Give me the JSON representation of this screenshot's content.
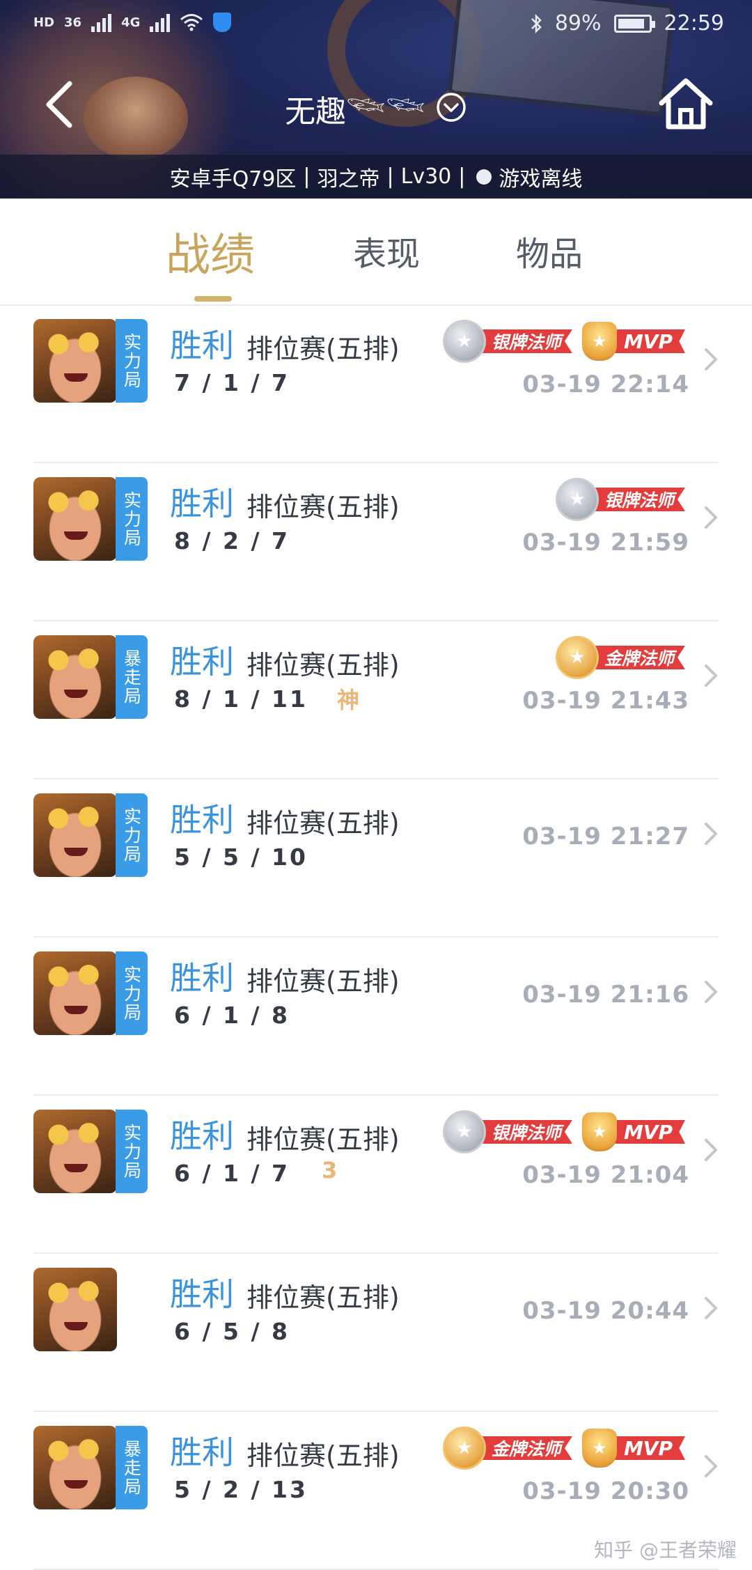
{
  "status_bar": {
    "network": "36",
    "network2": "4G",
    "carrier_label": "HD",
    "battery_percent": "89%",
    "battery_level": 0.89,
    "time": "22:59"
  },
  "header": {
    "title": "无趣𓆝𓆝",
    "info": {
      "server": "安卓手Q79区",
      "rank": "羽之帝",
      "level": "Lv30",
      "status": "游戏离线"
    }
  },
  "tabs": [
    {
      "label": "战绩",
      "active": true
    },
    {
      "label": "表现",
      "active": false
    },
    {
      "label": "物品",
      "active": false
    }
  ],
  "matches": [
    {
      "result": "胜利",
      "mode": "排位赛(五排)",
      "tag": "实力局",
      "kda": "7 / 1 / 7",
      "mark": "",
      "time": "03-19 22:14",
      "badge": "银牌法师",
      "badge_type": "silver",
      "mvp": "MVP"
    },
    {
      "result": "胜利",
      "mode": "排位赛(五排)",
      "tag": "实力局",
      "kda": "8 / 2 / 7",
      "mark": "",
      "time": "03-19 21:59",
      "badge": "银牌法师",
      "badge_type": "silver",
      "mvp": ""
    },
    {
      "result": "胜利",
      "mode": "排位赛(五排)",
      "tag": "暴走局",
      "kda": "8 / 1 / 11",
      "mark": "神",
      "time": "03-19 21:43",
      "badge": "金牌法师",
      "badge_type": "gold",
      "mvp": ""
    },
    {
      "result": "胜利",
      "mode": "排位赛(五排)",
      "tag": "实力局",
      "kda": "5 / 5 / 10",
      "mark": "",
      "time": "03-19 21:27",
      "badge": "",
      "badge_type": "",
      "mvp": ""
    },
    {
      "result": "胜利",
      "mode": "排位赛(五排)",
      "tag": "实力局",
      "kda": "6 / 1 / 8",
      "mark": "",
      "time": "03-19 21:16",
      "badge": "",
      "badge_type": "",
      "mvp": ""
    },
    {
      "result": "胜利",
      "mode": "排位赛(五排)",
      "tag": "实力局",
      "kda": "6 / 1 / 7",
      "mark": "3",
      "time": "03-19 21:04",
      "badge": "银牌法师",
      "badge_type": "silver",
      "mvp": "MVP"
    },
    {
      "result": "胜利",
      "mode": "排位赛(五排)",
      "tag": "",
      "kda": "6 / 5 / 8",
      "mark": "",
      "time": "03-19 20:44",
      "badge": "",
      "badge_type": "",
      "mvp": ""
    },
    {
      "result": "胜利",
      "mode": "排位赛(五排)",
      "tag": "暴走局",
      "kda": "5 / 2 / 13",
      "mark": "",
      "time": "03-19 20:30",
      "badge": "金牌法师",
      "badge_type": "gold",
      "mvp": "MVP"
    }
  ],
  "watermark": "知乎 @王者荣耀",
  "colors": {
    "accent_gold": "#c9a45c",
    "win_blue": "#3b93dd",
    "tag_blue": "#3a9ce6",
    "badge_red": "#e23c3c"
  }
}
